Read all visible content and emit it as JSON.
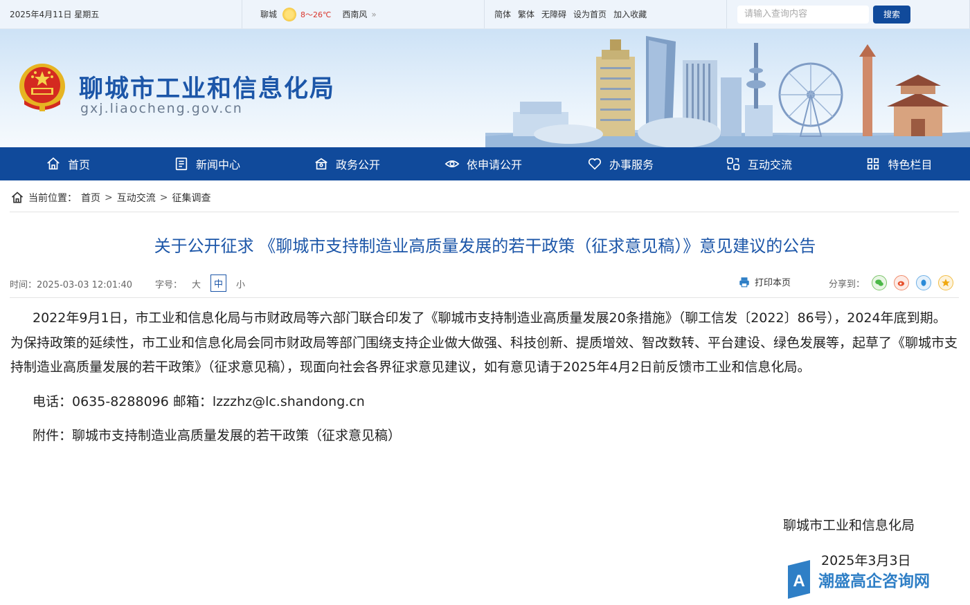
{
  "topbar": {
    "date": "2025年4月11日 星期五",
    "city": "聊城",
    "temp": "8～26℃",
    "wind": "西南风",
    "links": [
      "简体",
      "繁体",
      "无障碍",
      "设为首页",
      "加入收藏"
    ],
    "search_placeholder": "请输入查询内容",
    "search_button": "搜索"
  },
  "banner": {
    "title": "聊城市工业和信息化局",
    "url": "gxj.liaocheng.gov.cn"
  },
  "nav": [
    {
      "label": "首页",
      "icon": "home-icon"
    },
    {
      "label": "新闻中心",
      "icon": "newspaper-icon"
    },
    {
      "label": "政务公开",
      "icon": "building-icon"
    },
    {
      "label": "依申请公开",
      "icon": "eye-icon"
    },
    {
      "label": "办事服务",
      "icon": "heart-icon"
    },
    {
      "label": "互动交流",
      "icon": "interact-icon"
    },
    {
      "label": "特色栏目",
      "icon": "grid-icon"
    }
  ],
  "breadcrumb": {
    "prefix": "当前位置：",
    "items": [
      "首页",
      "互动交流",
      "征集调查"
    ],
    "sep": ">"
  },
  "article": {
    "title": "关于公开征求 《聊城市支持制造业高质量发展的若干政策（征求意见稿）》意见建议的公告",
    "time": "时间：2025-03-03 12:01:40",
    "font_label": "字号：",
    "font_sizes": [
      "大",
      "中",
      "小"
    ],
    "print": "打印本页",
    "share": "分享到：",
    "body": "2022年9月1日，市工业和信息化局与市财政局等六部门联合印发了《聊城市支持制造业高质量发展20条措施》（聊工信发〔2022〕86号），2024年底到期。为保持政策的延续性，市工业和信息化局会同市财政局等部门围绕支持企业做大做强、科技创新、提质增效、智改数转、平台建设、绿色发展等，起草了《聊城市支持制造业高质量发展的若干政策》（征求意见稿），现面向社会各界征求意见建议，如有意见请于2025年4月2日前反馈市工业和信息化局。",
    "contact": "电话：0635-8288096  邮箱：lzzzhz@lc.shandong.cn",
    "attachment": "附件：聊城市支持制造业高质量发展的若干政策（征求意见稿）",
    "signature": "聊城市工业和信息化局",
    "sign_date": "2025年3月3日"
  },
  "watermark": "潮盛高企咨询网",
  "colors": {
    "brand": "#104a9b",
    "title": "#1c56a8"
  }
}
